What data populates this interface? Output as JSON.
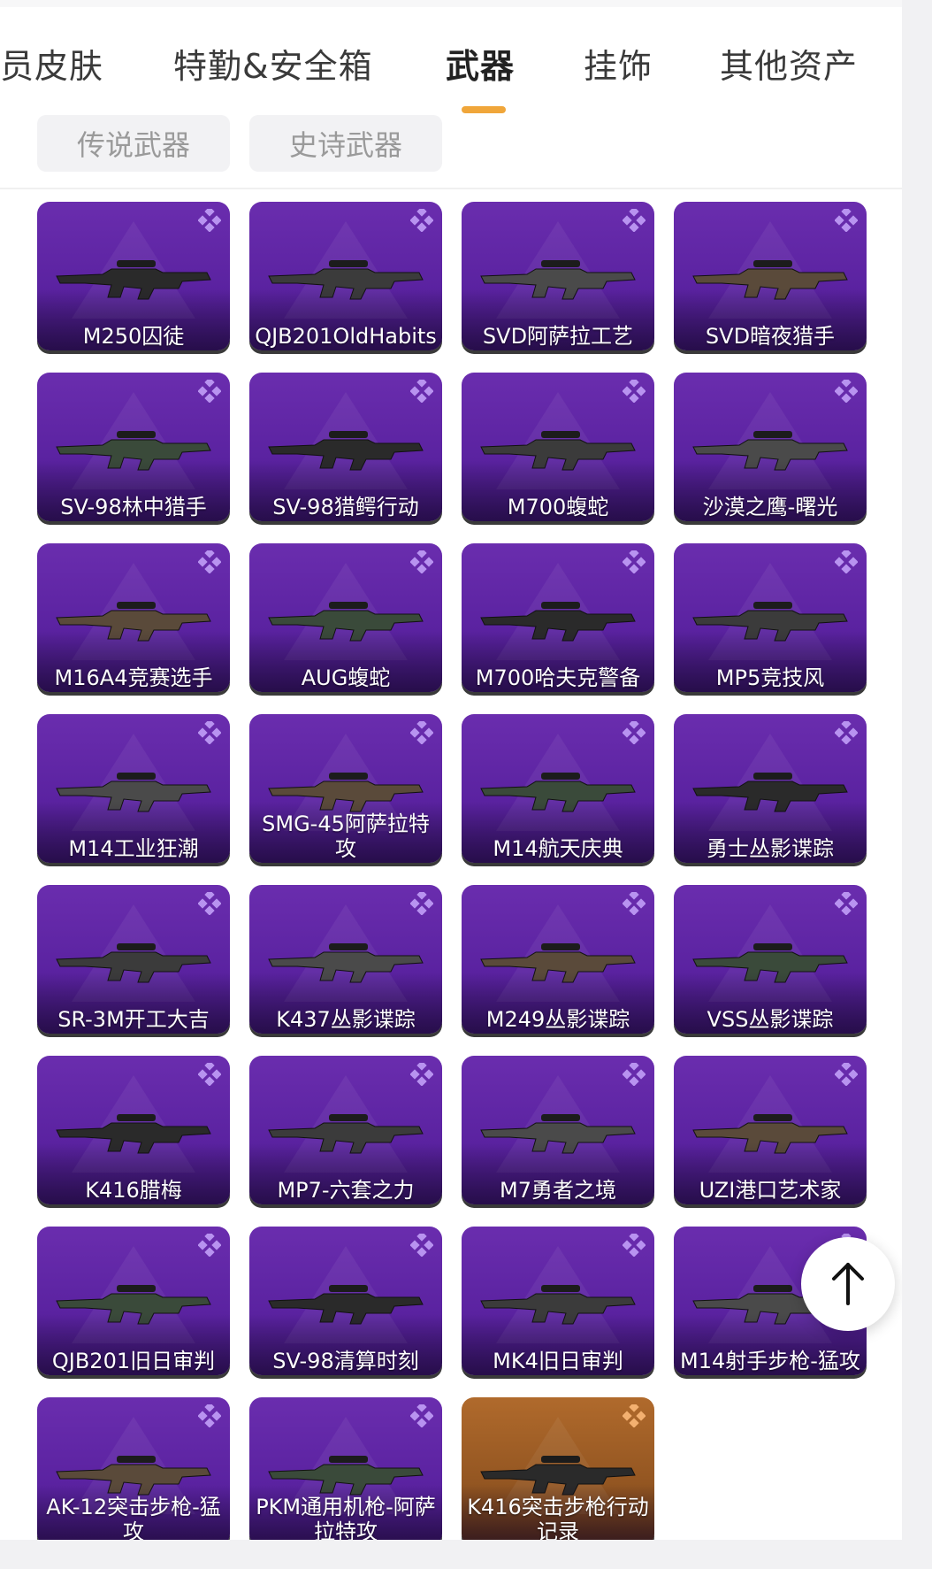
{
  "tabs": [
    {
      "label": "员皮肤"
    },
    {
      "label": "特勤&安全箱"
    },
    {
      "label": "武器",
      "active": true
    },
    {
      "label": "挂饰"
    },
    {
      "label": "其他资产"
    }
  ],
  "subtabs": [
    {
      "label": "传说武器"
    },
    {
      "label": "史诗武器"
    }
  ],
  "colors": {
    "accent": "#f0a63a",
    "epic_card": "#5a22a0",
    "legendary_card": "#925521"
  },
  "items": [
    {
      "name": "M250囚徒",
      "rarity": "epic"
    },
    {
      "name": "QJB201OldHabits",
      "rarity": "epic"
    },
    {
      "name": "SVD阿萨拉工艺",
      "rarity": "epic"
    },
    {
      "name": "SVD暗夜猎手",
      "rarity": "epic"
    },
    {
      "name": "SV-98林中猎手",
      "rarity": "epic"
    },
    {
      "name": "SV-98猎鳄行动",
      "rarity": "epic"
    },
    {
      "name": "M700蝮蛇",
      "rarity": "epic"
    },
    {
      "name": "沙漠之鹰-曙光",
      "rarity": "epic"
    },
    {
      "name": "M16A4竞赛选手",
      "rarity": "epic"
    },
    {
      "name": "AUG蝮蛇",
      "rarity": "epic"
    },
    {
      "name": "M700哈夫克警备",
      "rarity": "epic"
    },
    {
      "name": "MP5竞技风",
      "rarity": "epic"
    },
    {
      "name": "M14工业狂潮",
      "rarity": "epic"
    },
    {
      "name": "SMG-45阿萨拉特攻",
      "rarity": "epic"
    },
    {
      "name": "M14航天庆典",
      "rarity": "epic"
    },
    {
      "name": "勇士丛影谍踪",
      "rarity": "epic"
    },
    {
      "name": "SR-3M开工大吉",
      "rarity": "epic"
    },
    {
      "name": "K437丛影谍踪",
      "rarity": "epic"
    },
    {
      "name": "M249丛影谍踪",
      "rarity": "epic"
    },
    {
      "name": "VSS丛影谍踪",
      "rarity": "epic"
    },
    {
      "name": "K416腊梅",
      "rarity": "epic"
    },
    {
      "name": "MP7-六套之力",
      "rarity": "epic"
    },
    {
      "name": "M7勇者之境",
      "rarity": "epic"
    },
    {
      "name": "UZI港口艺术家",
      "rarity": "epic"
    },
    {
      "name": "QJB201旧日审判",
      "rarity": "epic"
    },
    {
      "name": "SV-98清算时刻",
      "rarity": "epic"
    },
    {
      "name": "MK4旧日审判",
      "rarity": "epic"
    },
    {
      "name": "M14射手步枪-猛攻",
      "rarity": "epic"
    },
    {
      "name": "AK-12突击步枪-猛攻",
      "rarity": "epic"
    },
    {
      "name": "PKM通用机枪-阿萨拉特攻",
      "rarity": "epic"
    },
    {
      "name": "K416突击步枪行动记录",
      "rarity": "legendary"
    }
  ],
  "back_to_top": {
    "icon": "arrow-up-icon"
  }
}
